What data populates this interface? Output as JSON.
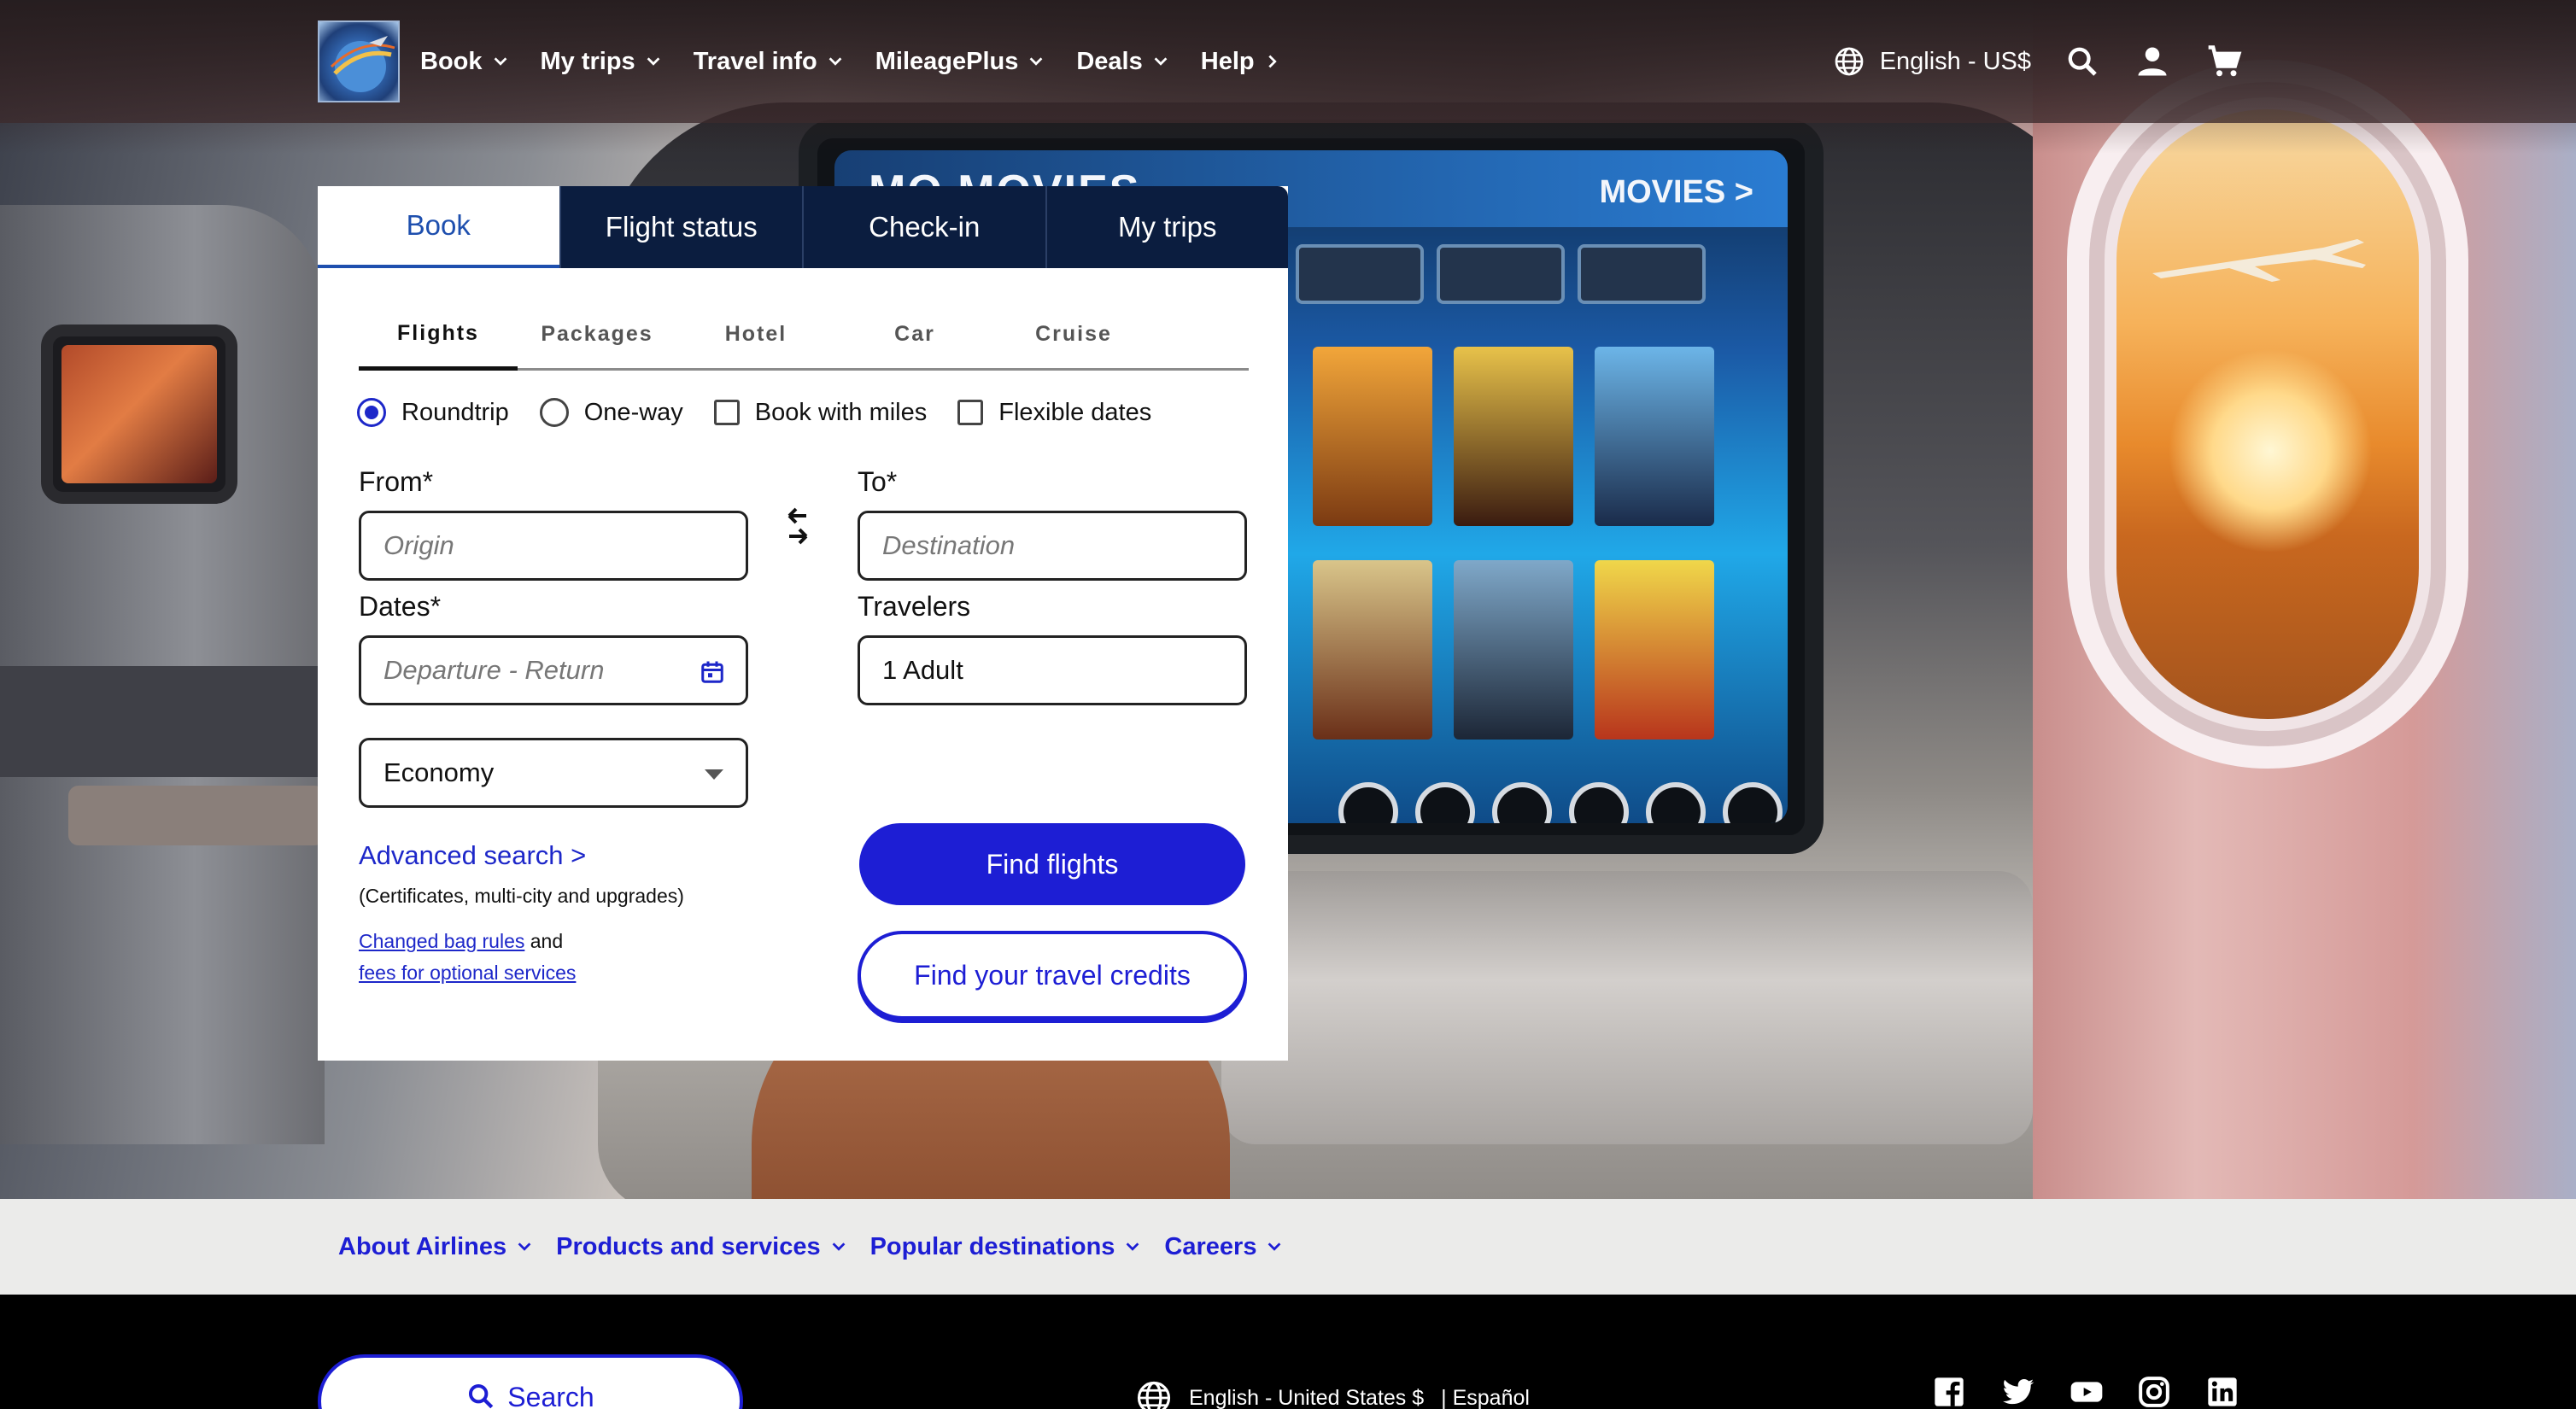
{
  "nav": {
    "items": [
      {
        "label": "Book",
        "icon": "chevron-down-icon"
      },
      {
        "label": "My trips",
        "icon": "chevron-down-icon"
      },
      {
        "label": "Travel info",
        "icon": "chevron-down-icon"
      },
      {
        "label": "MileagePlus",
        "icon": "chevron-down-icon"
      },
      {
        "label": "Deals",
        "icon": "chevron-down-icon"
      },
      {
        "label": "Help",
        "icon": "chevron-right-icon"
      }
    ],
    "language": "English - US$"
  },
  "hero": {
    "ife_title": "MO MOVIES",
    "ife_title_right": "MOVIES >"
  },
  "widget": {
    "tabs": [
      "Book",
      "Flight status",
      "Check-in",
      "My trips"
    ],
    "subtabs": [
      "Flights",
      "Packages",
      "Hotel",
      "Car",
      "Cruise"
    ],
    "trip_options": [
      {
        "label": "Roundtrip",
        "type": "radio",
        "checked": true
      },
      {
        "label": "One-way",
        "type": "radio",
        "checked": false
      },
      {
        "label": "Book with miles",
        "type": "checkbox",
        "checked": false
      },
      {
        "label": "Flexible dates",
        "type": "checkbox",
        "checked": false
      }
    ],
    "from_label": "From*",
    "from_placeholder": "Origin",
    "to_label": "To*",
    "to_placeholder": "Destination",
    "dates_label": "Dates*",
    "dates_placeholder": "Departure - Return",
    "travelers_label": "Travelers",
    "travelers_value": "1 Adult",
    "cabin_value": "Economy",
    "advanced_search": "Advanced search >",
    "advanced_note": "(Certificates, multi-city and upgrades)",
    "bag_rules_link": "Changed bag rules",
    "and_text": "and",
    "fees_link": "fees for optional services",
    "find_flights": "Find flights",
    "travel_credits": "Find your travel credits"
  },
  "footer_links": [
    "About Airlines",
    "Products and services",
    "Popular destinations",
    "Careers"
  ],
  "footer": {
    "search_label": "Search",
    "language": "English - United States $",
    "alt_language": "| Español",
    "social": [
      "facebook-icon",
      "twitter-icon",
      "youtube-icon",
      "instagram-icon",
      "linkedin-icon"
    ]
  },
  "colors": {
    "primary_blue": "#1d1ed4",
    "nav_dark": "#0b1d3f",
    "link_blue": "#1e4fae"
  }
}
